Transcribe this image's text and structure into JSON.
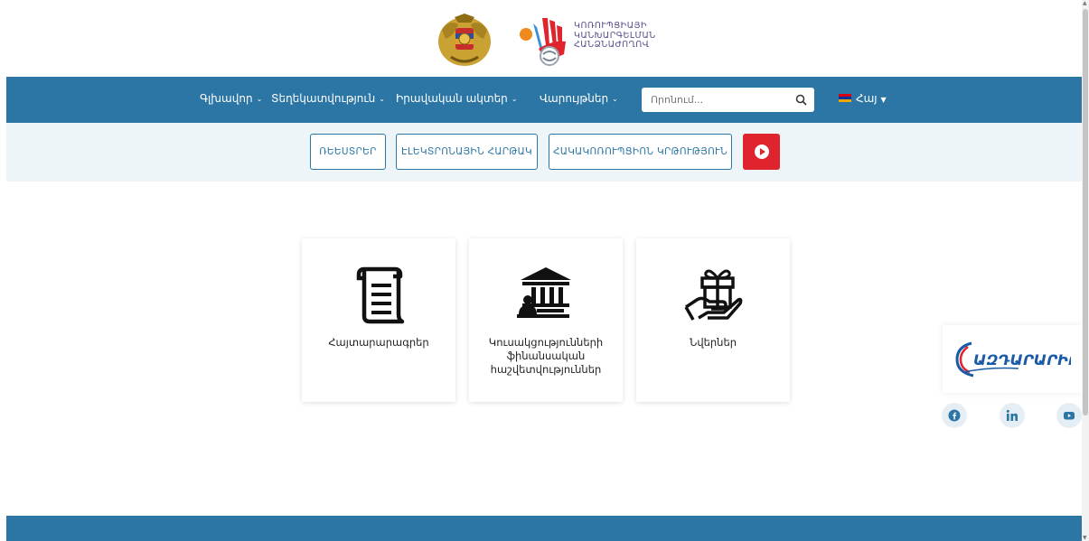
{
  "header": {
    "logo_lines": [
      "ԿՈՌՈՒՊՑԻԱՅԻ",
      "ԿԱՆԽԱՐԳԵԼՄԱՆ",
      "ՀԱՆՁՆԱԺՈՂՈՎ"
    ]
  },
  "nav": {
    "items": [
      {
        "label": "Գլխավոր"
      },
      {
        "label": "Տեղեկատվություն"
      },
      {
        "label": "Իրավական ակտեր"
      },
      {
        "label": "Վարույթներ"
      }
    ],
    "search_placeholder": "Որոնում...",
    "language": "Հայ"
  },
  "subbar": {
    "buttons": [
      {
        "label": "ՌԵԵՍՏՐԵՐ"
      },
      {
        "label": "ԷԼԵԿՏՐՈՆԱՅԻՆ ՀԱՐԹԱԿ"
      },
      {
        "label": "ՀԱԿԱԿՈՌՈՒՊՑԻՈՆ ԿՐԹՈՒԹՅՈՒՆ"
      }
    ]
  },
  "cards": [
    {
      "label": "Հայտարարագրեր",
      "icon": "scroll-document-icon"
    },
    {
      "label": "Կուսակցությունների ֆինանսական հաշվետվություններ",
      "icon": "government-building-icon"
    },
    {
      "label": "Նվերներ",
      "icon": "gift-hand-icon"
    }
  ],
  "widget": {
    "brand": "ԱԶԴԱՐԱՐԻՐ"
  },
  "social": [
    "facebook-icon",
    "linkedin-icon",
    "youtube-icon"
  ],
  "colors": {
    "primary": "#2b76a4",
    "accent_red": "#e0242d",
    "subbar_bg": "#eef5f9"
  }
}
